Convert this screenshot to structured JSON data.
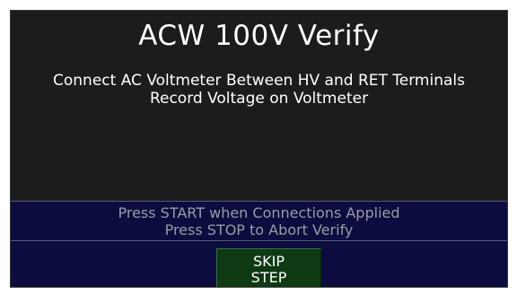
{
  "screen": {
    "title": "ACW 100V Verify",
    "instructions": [
      "Connect AC Voltmeter Between HV and RET Terminals",
      "Record Voltage on Voltmeter"
    ],
    "prompts": [
      "Press START when Connections Applied",
      "Press STOP to Abort Verify"
    ],
    "skip_button": {
      "line1": "SKIP",
      "line2": "STEP"
    }
  },
  "colors": {
    "screen_background": "#1c1c1c",
    "prompt_bar_background": "#0c0c3e",
    "prompt_text": "#9a9aa6",
    "skip_button_background": "#0d3a12",
    "text": "#ffffff"
  }
}
